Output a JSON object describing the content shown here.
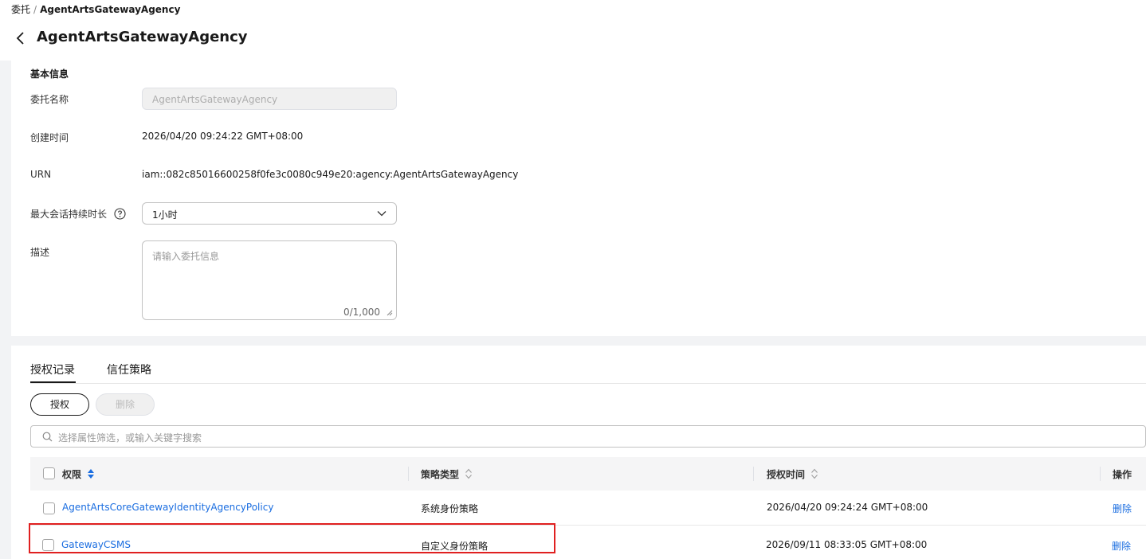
{
  "breadcrumb": {
    "parent": "委托",
    "separator": "/",
    "current": "AgentArtsGatewayAgency"
  },
  "page_title": "AgentArtsGatewayAgency",
  "basic_info": {
    "section_title": "基本信息",
    "agency_name_label": "委托名称",
    "agency_name_value": "AgentArtsGatewayAgency",
    "created_label": "创建时间",
    "created_value": "2026/04/20 09:24:22 GMT+08:00",
    "urn_label": "URN",
    "urn_value": "iam::082c85016600258f0fe3c0080c949e20:agency:AgentArtsGatewayAgency",
    "duration_label": "最大会话持续时长",
    "duration_value": "1小时",
    "desc_label": "描述",
    "desc_placeholder": "请输入委托信息",
    "desc_counter": "0/1,000"
  },
  "tabs": [
    {
      "label": "授权记录",
      "active": true
    },
    {
      "label": "信任策略",
      "active": false
    }
  ],
  "actions": {
    "authorize": "授权",
    "delete": "删除"
  },
  "search": {
    "placeholder": "选择属性筛选，或输入关键字搜索"
  },
  "table": {
    "columns": [
      "权限",
      "策略类型",
      "授权时间",
      "操作"
    ],
    "rows": [
      {
        "permission": "AgentArtsCoreGatewayIdentityAgencyPolicy",
        "type": "系统身份策略",
        "time": "2026/04/20 09:24:24 GMT+08:00",
        "action": "删除"
      },
      {
        "permission": "GatewayCSMS",
        "type": "自定义身份策略",
        "time": "2026/09/11 08:33:05 GMT+08:00",
        "action": "删除"
      }
    ]
  },
  "colors": {
    "link": "#1a6de0",
    "highlight_border": "#e02020",
    "sort_active": "#1a6de0"
  },
  "icons": [
    "back-arrow-icon",
    "help-circle-icon",
    "chevron-down-icon",
    "resize-handle-icon",
    "search-icon",
    "sort-icon"
  ]
}
